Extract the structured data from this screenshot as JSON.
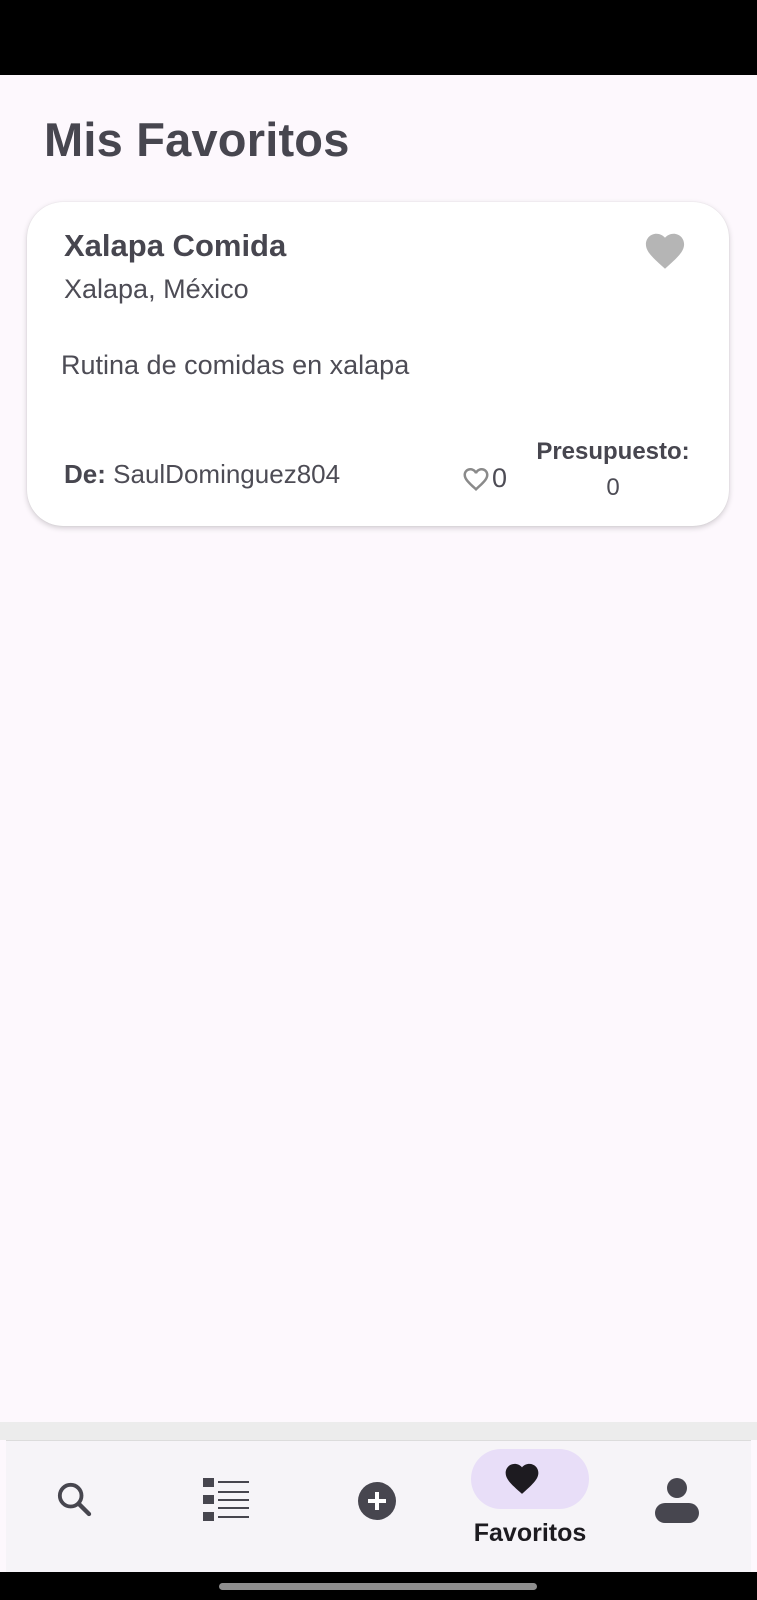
{
  "page": {
    "title": "Mis Favoritos"
  },
  "favorites": [
    {
      "title": "Xalapa Comida",
      "location": "Xalapa, México",
      "description": "Rutina de comidas en xalapa",
      "author_prefix": "De:",
      "author": "SaulDominguez804",
      "likes": "0",
      "budget_label": "Presupuesto:",
      "budget_value": "0",
      "favorite_icon": "heart-filled-icon",
      "likes_icon": "heart-outline-icon"
    }
  ],
  "bottom_nav": {
    "active": "Favoritos",
    "items": [
      {
        "id": "search",
        "icon": "search-icon"
      },
      {
        "id": "list",
        "icon": "list-icon"
      },
      {
        "id": "add",
        "icon": "add-circle-icon"
      },
      {
        "id": "favorites",
        "icon": "heart-icon",
        "label": "Favoritos"
      },
      {
        "id": "profile",
        "icon": "person-icon"
      }
    ]
  },
  "colors": {
    "background": "#fdf8fd",
    "card": "#ffffff",
    "text": "#47464f",
    "favorite_heart": "#b5b5b5",
    "nav_active_pill": "#e8def8",
    "nav_icon": "#47464f"
  }
}
